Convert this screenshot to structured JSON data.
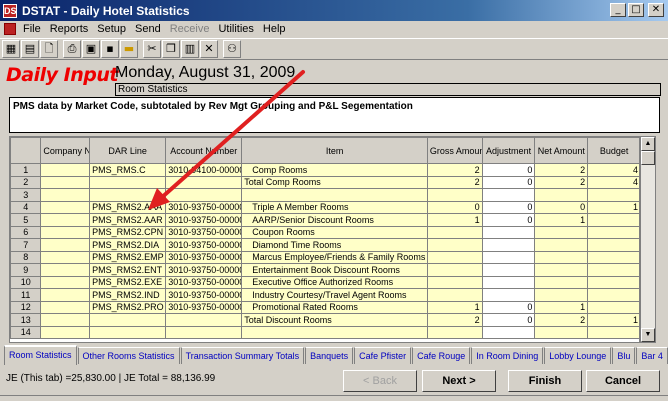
{
  "window": {
    "title": "DSTAT - Daily Hotel Statistics",
    "app_icon": "DS",
    "min": "_",
    "max": "□",
    "close": "✕"
  },
  "menu": [
    "File",
    "Reports",
    "Setup",
    "Send",
    "Receive",
    "Utilities",
    "Help"
  ],
  "toolbar_icons": [
    "grid-icon",
    "table-icon",
    "new-document-icon",
    "print-icon",
    "disk-icon",
    "save-icon",
    "highlight-icon",
    "scissors-icon",
    "copy-icon",
    "paste-icon",
    "delete-icon",
    "network-icon"
  ],
  "header": {
    "logo": "Daily Input",
    "date": "Monday, August 31, 2009",
    "section": "Room Statistics",
    "description": "PMS data by Market Code, subtotaled by Rev Mgt Grouping and P&L Segementation"
  },
  "grid": {
    "columns": [
      "",
      "Company No.",
      "DAR Line",
      "Account Number",
      "Item",
      "Gross Amount",
      "Adjustment",
      "Net Amount",
      "Budget"
    ],
    "rows": [
      {
        "n": "1",
        "company": "",
        "dar": "PMS_RMS.C",
        "account": "3010-94100-00000",
        "item": "Comp Rooms",
        "gross": "2",
        "adj": "0",
        "net": "2",
        "budget": "4"
      },
      {
        "n": "2",
        "company": "",
        "dar": "",
        "account": "",
        "item": "Total Comp Rooms",
        "gross": "2",
        "adj": "0",
        "net": "2",
        "budget": "4"
      },
      {
        "n": "3",
        "company": "",
        "dar": "",
        "account": "",
        "item": "",
        "gross": "",
        "adj": "",
        "net": "",
        "budget": ""
      },
      {
        "n": "4",
        "company": "",
        "dar": "PMS_RMS2.AAA",
        "account": "3010-93750-00000",
        "item": "Triple A Member Rooms",
        "gross": "0",
        "adj": "0",
        "net": "0",
        "budget": "1"
      },
      {
        "n": "5",
        "company": "",
        "dar": "PMS_RMS2.AAR",
        "account": "3010-93750-00000",
        "item": "AARP/Senior Discount Rooms",
        "gross": "1",
        "adj": "0",
        "net": "1",
        "budget": ""
      },
      {
        "n": "6",
        "company": "",
        "dar": "PMS_RMS2.CPN",
        "account": "3010-93750-00000",
        "item": "Coupon Rooms",
        "gross": "",
        "adj": "",
        "net": "",
        "budget": ""
      },
      {
        "n": "7",
        "company": "",
        "dar": "PMS_RMS2.DIA",
        "account": "3010-93750-00000",
        "item": "Diamond Time Rooms",
        "gross": "",
        "adj": "",
        "net": "",
        "budget": ""
      },
      {
        "n": "8",
        "company": "",
        "dar": "PMS_RMS2.EMP",
        "account": "3010-93750-00000",
        "item": "Marcus Employee/Friends & Family Rooms",
        "gross": "",
        "adj": "",
        "net": "",
        "budget": ""
      },
      {
        "n": "9",
        "company": "",
        "dar": "PMS_RMS2.ENT",
        "account": "3010-93750-00000",
        "item": "Entertainment Book Discount Rooms",
        "gross": "",
        "adj": "",
        "net": "",
        "budget": ""
      },
      {
        "n": "10",
        "company": "",
        "dar": "PMS_RMS2.EXE",
        "account": "3010-93750-00000",
        "item": "Executive Office Authorized Rooms",
        "gross": "",
        "adj": "",
        "net": "",
        "budget": ""
      },
      {
        "n": "11",
        "company": "",
        "dar": "PMS_RMS2.IND",
        "account": "3010-93750-00000",
        "item": "Industry Courtesy/Travel Agent Rooms",
        "gross": "",
        "adj": "",
        "net": "",
        "budget": ""
      },
      {
        "n": "12",
        "company": "",
        "dar": "PMS_RMS2.PRO",
        "account": "3010-93750-00000",
        "item": "Promotional Rated Rooms",
        "gross": "1",
        "adj": "0",
        "net": "1",
        "budget": ""
      },
      {
        "n": "13",
        "company": "",
        "dar": "",
        "account": "",
        "item": "Total Discount Rooms",
        "gross": "2",
        "adj": "0",
        "net": "2",
        "budget": "1"
      },
      {
        "n": "14",
        "company": "",
        "dar": "",
        "account": "",
        "item": "",
        "gross": "",
        "adj": "",
        "net": "",
        "budget": ""
      }
    ]
  },
  "tabs": [
    "Room Statistics",
    "Other Rooms Statistics",
    "Transaction Summary Totals",
    "Banquets",
    "Cafe Pfister",
    "Cafe Rouge",
    "In Room Dining",
    "Lobby Lounge",
    "Blu",
    "Bar 4"
  ],
  "footer": {
    "totals": "JE (This tab) =25,830.00 | JE Total = 88,136.99",
    "back": "< Back",
    "next": "Next >",
    "finish": "Finish",
    "cancel": "Cancel"
  },
  "colors": {
    "grid_fill": "#ffffc8",
    "logo": "#e00000",
    "arrow": "#e02020",
    "tab_text": "#0000c0"
  }
}
